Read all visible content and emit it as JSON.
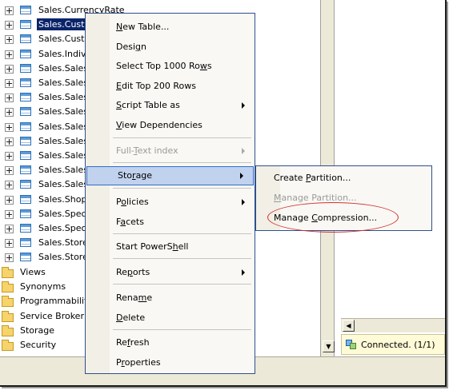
{
  "tree": {
    "tables": [
      "Sales.CurrencyRate",
      "Sales.Custo",
      "Sales.Custo",
      "Sales.Indiv",
      "Sales.Sales",
      "Sales.Sales",
      "Sales.Sales",
      "Sales.Sales",
      "Sales.Sales",
      "Sales.Sales",
      "Sales.Sales",
      "Sales.Sales",
      "Sales.Sales",
      "Sales.Shop",
      "Sales.Spec",
      "Sales.Spec",
      "Sales.Store",
      "Sales.Store"
    ],
    "selected_index": 1,
    "folders": [
      "Views",
      "Synonyms",
      "Programmability",
      "Service Broker",
      "Storage",
      "Security"
    ]
  },
  "context_menu": {
    "items": [
      {
        "label": "New Table...",
        "mnemonic": "N",
        "submenu": false,
        "disabled": false
      },
      {
        "label": "Design",
        "mnemonic": "g",
        "submenu": false,
        "disabled": false
      },
      {
        "label": "Select Top 1000 Rows",
        "mnemonic": "w",
        "submenu": false,
        "disabled": false
      },
      {
        "label": "Edit Top 200 Rows",
        "mnemonic": "E",
        "submenu": false,
        "disabled": false
      },
      {
        "label": "Script Table as",
        "mnemonic": "S",
        "submenu": true,
        "disabled": false
      },
      {
        "label": "View Dependencies",
        "mnemonic": "V",
        "submenu": false,
        "disabled": false
      },
      {
        "label": "Full-Text index",
        "mnemonic": "T",
        "submenu": true,
        "disabled": true
      },
      {
        "label": "Storage",
        "mnemonic": "r",
        "submenu": true,
        "disabled": false,
        "highlighted": true
      },
      {
        "label": "Policies",
        "mnemonic": "o",
        "submenu": true,
        "disabled": false
      },
      {
        "label": "Facets",
        "mnemonic": "a",
        "submenu": false,
        "disabled": false
      },
      {
        "label": "Start PowerShell",
        "mnemonic": "h",
        "submenu": false,
        "disabled": false
      },
      {
        "label": "Reports",
        "mnemonic": "p",
        "submenu": true,
        "disabled": false
      },
      {
        "label": "Rename",
        "mnemonic": "m",
        "submenu": false,
        "disabled": false
      },
      {
        "label": "Delete",
        "mnemonic": "D",
        "submenu": false,
        "disabled": false
      },
      {
        "label": "Refresh",
        "mnemonic": "f",
        "submenu": false,
        "disabled": false
      },
      {
        "label": "Properties",
        "mnemonic": "r",
        "submenu": false,
        "disabled": false
      }
    ]
  },
  "storage_submenu": {
    "items": [
      {
        "label": "Create Partition...",
        "mnemonic": "P",
        "disabled": false
      },
      {
        "label": "Manage Partition...",
        "mnemonic": "M",
        "disabled": true
      },
      {
        "label": "Manage Compression...",
        "mnemonic": "C",
        "disabled": false
      }
    ]
  },
  "status": {
    "connection_text": "Connected. (1/1)"
  },
  "colors": {
    "selection": "#0a246a",
    "menu_highlight": "#c1d2ee",
    "annotation_ring": "#d03030"
  }
}
